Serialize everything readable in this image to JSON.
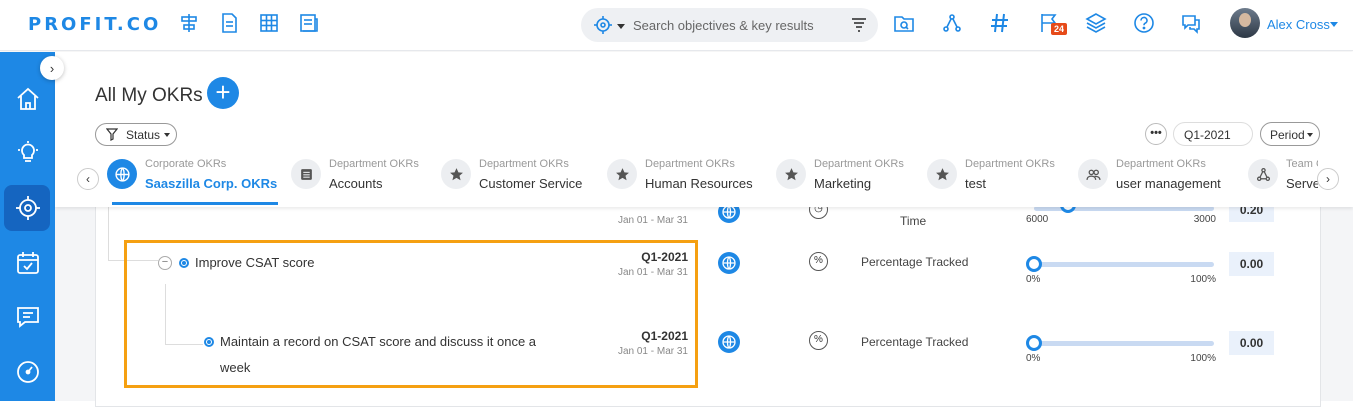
{
  "app": {
    "logo": "PROFIT.CO"
  },
  "topbar": {
    "search_placeholder": "Search objectives & key results",
    "notification_count": "24",
    "user_name": "Alex Cross"
  },
  "page": {
    "title": "All My OKRs",
    "add_label": "+"
  },
  "filters": {
    "status_label": "Status",
    "more_label": "•••",
    "quarter_value": "Q1-2021",
    "period_label": "Period"
  },
  "tabs": [
    {
      "kind": "Corporate OKRs",
      "name": "Saaszilla Corp. OKRs",
      "icon": "globe-icon"
    },
    {
      "kind": "Department OKRs",
      "name": "Accounts",
      "icon": "list-icon"
    },
    {
      "kind": "Department OKRs",
      "name": "Customer Service",
      "icon": "star-icon"
    },
    {
      "kind": "Department OKRs",
      "name": "Human Resources",
      "icon": "star-icon"
    },
    {
      "kind": "Department OKRs",
      "name": "Marketing",
      "icon": "star-icon"
    },
    {
      "kind": "Department OKRs",
      "name": "test",
      "icon": "star-icon"
    },
    {
      "kind": "Department OKRs",
      "name": "user management",
      "icon": "users-icon"
    },
    {
      "kind": "Team O",
      "name": "Serve",
      "icon": "hierarchy-icon"
    }
  ],
  "rows": [
    {
      "title": "",
      "quarter": "",
      "dates": "Jan 01 - Mar 31",
      "tracking": "Time",
      "min": "6000",
      "max": "3000",
      "value": "0.20"
    },
    {
      "title": "Improve CSAT score",
      "quarter": "Q1-2021",
      "dates": "Jan 01 - Mar 31",
      "tracking": "Percentage Tracked",
      "min": "0%",
      "max": "100%",
      "value": "0.00",
      "progress": 0
    },
    {
      "title": "Maintain a record on CSAT score and discuss it once a week",
      "quarter": "Q1-2021",
      "dates": "Jan 01 - Mar 31",
      "tracking": "Percentage Tracked",
      "min": "0%",
      "max": "100%",
      "value": "0.00",
      "progress": 0
    }
  ],
  "colors": {
    "brand": "#1e88e5",
    "highlight": "#f5a011",
    "badge": "#e64a19"
  }
}
